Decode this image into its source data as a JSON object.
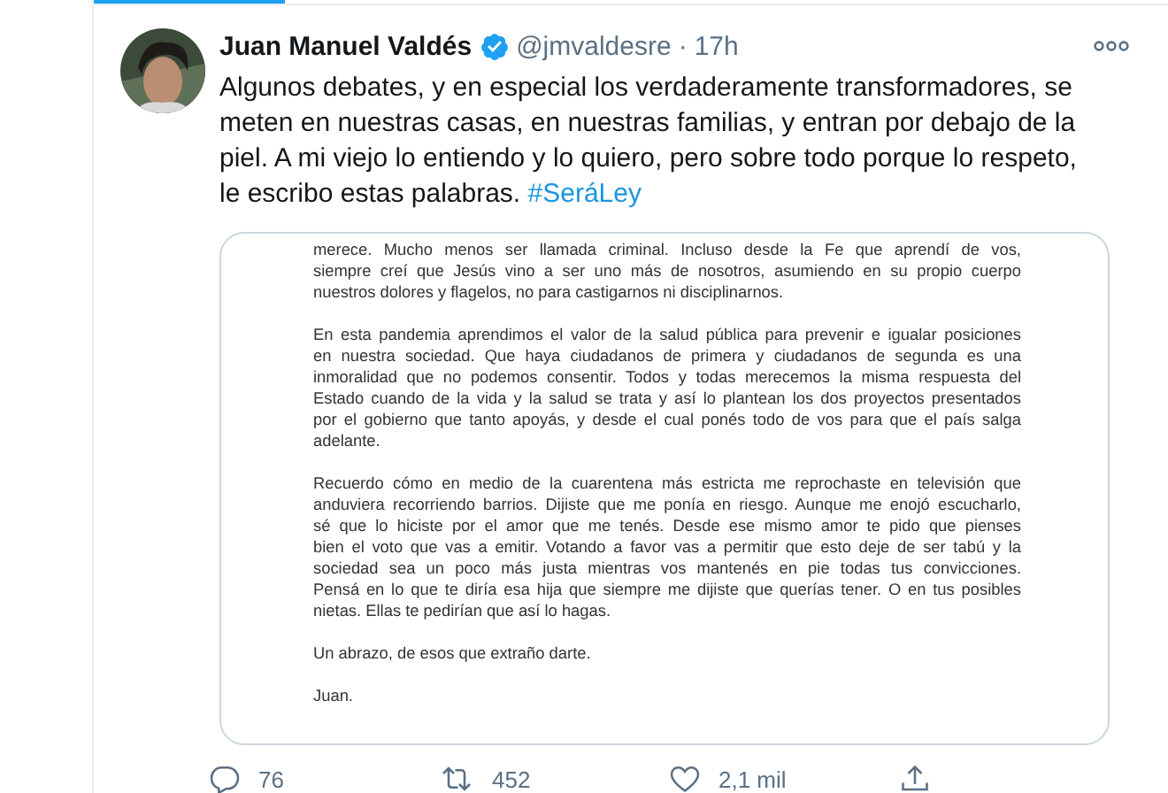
{
  "tweet": {
    "name": "Juan Manuel Valdés",
    "verified": true,
    "handle": "@jmvaldesre",
    "separator": "·",
    "time": "17h",
    "text": "Algunos debates, y en especial los verdaderamente transformadores, se meten en nuestras casas, en nuestras familias, y entran por debajo de la piel. A mi viejo lo entiendo y lo quiero, pero sobre todo porque lo respeto, le escribo estas palabras.",
    "hashtag": "#SeráLey"
  },
  "letter": {
    "paragraphs": [
      [
        "merece. Mucho menos ser llamada criminal. Incluso desde la Fe que aprendí de vos,",
        "siempre creí que Jesús vino a ser uno más de nosotros, asumiendo en su propio cuerpo",
        "nuestros dolores y flagelos, no para castigarnos ni disciplinarnos."
      ],
      [
        "En esta pandemia aprendimos el valor de la salud pública para prevenir e igualar posiciones",
        "en nuestra sociedad. Que haya ciudadanos de primera y ciudadanos de segunda es una",
        "inmoralidad que no podemos consentir. Todos y todas merecemos la misma respuesta del",
        "Estado cuando de la vida y la salud se trata  y así lo plantean los dos proyectos presentados",
        "por el gobierno que tanto apoyás, y desde el cual ponés todo de vos para que el país salga",
        "adelante."
      ],
      [
        "Recuerdo cómo en medio de la cuarentena más estricta me reprochaste en televisión que",
        "anduviera recorriendo barrios. Dijiste que me ponía en riesgo. Aunque me enojó escucharlo,",
        "sé que lo hiciste por el amor que me tenés. Desde ese mismo amor te pido que pienses",
        "bien el voto que vas a emitir. Votando a favor vas a permitir que esto deje de ser tabú y la",
        "sociedad sea un poco más justa mientras vos mantenés en pie todas tus convicciones.",
        "Pensá en lo que te diría esa hija que siempre me dijiste que querías tener. O en tus posibles",
        "nietas. Ellas te pedirían que así lo hagas."
      ],
      [
        "Un abrazo, de esos que extraño darte."
      ],
      [
        "Juan."
      ]
    ]
  },
  "actions": [
    {
      "kind": "reply",
      "count": "76"
    },
    {
      "kind": "retweet",
      "count": "452"
    },
    {
      "kind": "like",
      "count": "2,1 mil"
    },
    {
      "kind": "share"
    }
  ]
}
